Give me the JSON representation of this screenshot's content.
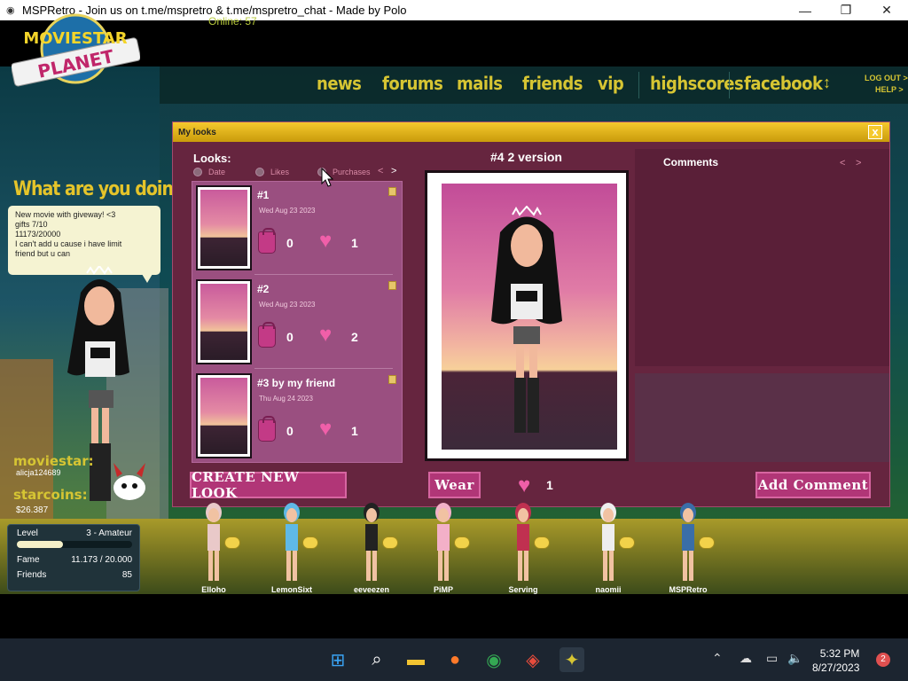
{
  "window": {
    "title": "MSPRetro - Join us on t.me/mspretro & t.me/mspretro_chat - Made by Polo",
    "minimize": "—",
    "maximize": "❐",
    "close": "✕",
    "app_icon": "eye-icon"
  },
  "topnav": {
    "online": "Online: 57",
    "items": [
      "news",
      "forums",
      "mails",
      "friends",
      "vip",
      "highscores",
      "facebook"
    ],
    "sort_icon": "↕",
    "logout": "LOG OUT >",
    "help": "HELP >"
  },
  "left_panel": {
    "logo_top": "MOVIESTAR",
    "logo_bottom": "PLANET",
    "prompt": "What are you doing?",
    "status_lines": [
      "New movie with  giveway! <3",
      "gifts 7/10",
      "11173/20000",
      "I can't add u cause i have limit",
      "friend but u can"
    ],
    "moviestar_label": "moviestar:",
    "moviestar_name": "alicja124689",
    "starcoins_label": "starcoins:",
    "starcoins_value": "$26.387",
    "level_label": "Level",
    "level_value": "3 - Amateur",
    "level_progress": 0.4,
    "fame_label": "Fame",
    "fame_value": "11.173 / 20.000",
    "friends_label": "Friends",
    "friends_value": "85"
  },
  "dialog": {
    "title": "My looks",
    "close": "x",
    "looks_label": "Looks:",
    "sort_options": [
      "Date",
      "Likes",
      "Purchases"
    ],
    "pager_prev": "<",
    "pager_next": ">",
    "looks": [
      {
        "name": "#1",
        "date": "Wed Aug 23 2023",
        "purchases": "0",
        "likes": "1"
      },
      {
        "name": "#2",
        "date": "Wed Aug 23 2023",
        "purchases": "0",
        "likes": "2"
      },
      {
        "name": "#3 by my friend",
        "date": "Thu Aug 24 2023",
        "purchases": "0",
        "likes": "1"
      }
    ],
    "preview_title": "#4 2 version",
    "comments_label": "Comments",
    "comments_prev": "<",
    "comments_next": ">",
    "create_button": "CREATE NEW LOOK",
    "wear_button": "Wear",
    "preview_likes": "1",
    "add_comment_button": "Add Comment"
  },
  "friends_bar": [
    "Elloho",
    "LemonSixt",
    "eeveezen",
    "PiMP",
    "Serving",
    "naomii",
    "MSPRetro"
  ],
  "taskbar": {
    "time": "5:32 PM",
    "date": "8/27/2023",
    "notifications": "2",
    "icons": [
      "windows-start-icon",
      "search-icon",
      "file-explorer-icon",
      "firefox-icon",
      "chrome-icon",
      "app-icon",
      "msp-icon"
    ]
  },
  "colors": {
    "dialog_bg": "#66253f",
    "title_bar": "#f5c92d",
    "button": "#b13677",
    "nav_text": "#d6c533"
  }
}
